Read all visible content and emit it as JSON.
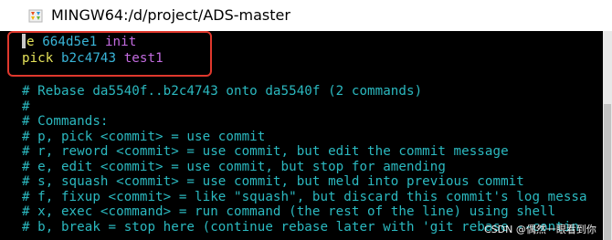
{
  "window": {
    "title": "MINGW64:/d/project/ADS-master",
    "icon": "git-bash-icon"
  },
  "colors": {
    "comment": "#2bb9c0",
    "command_word": "#e6e35a",
    "hash": "#39b5d8",
    "message": "#c36be0",
    "highlight": "#e0382d"
  },
  "todo": [
    {
      "command": "e",
      "hash": "664d5e1",
      "message": "init"
    },
    {
      "command": "pick",
      "hash": "b2c4743",
      "message": "test1"
    }
  ],
  "comments": [
    "# Rebase da5540f..b2c4743 onto da5540f (2 commands)",
    "#",
    "# Commands:",
    "# p, pick <commit> = use commit",
    "# r, reword <commit> = use commit, but edit the commit message",
    "# e, edit <commit> = use commit, but stop for amending",
    "# s, squash <commit> = use commit, but meld into previous commit",
    "# f, fixup <commit> = like \"squash\", but discard this commit's log messa",
    "# x, exec <command> = run command (the rest of the line) using shell",
    "# b, break = stop here (continue rebase later with 'git rebase --contin"
  ],
  "watermark": "CSDN @偶然一眼看到你"
}
